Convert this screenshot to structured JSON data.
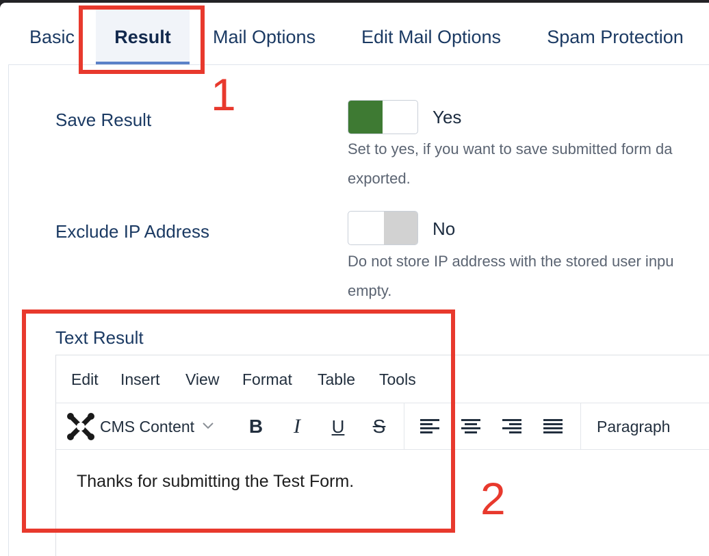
{
  "tabs": [
    {
      "label": "Basic"
    },
    {
      "label": "Result",
      "active": true
    },
    {
      "label": "Mail Options"
    },
    {
      "label": "Edit Mail Options"
    },
    {
      "label": "Spam Protection"
    }
  ],
  "fields": {
    "save_result": {
      "label": "Save Result",
      "value": "Yes",
      "hint_line1": "Set to yes, if you want to save submitted form da",
      "hint_line2": "exported."
    },
    "exclude_ip": {
      "label": "Exclude IP Address",
      "value": "No",
      "hint_line1": "Do not store IP address with the stored user inpu",
      "hint_line2": "empty."
    },
    "text_result": {
      "label": "Text Result"
    }
  },
  "editor": {
    "menu": [
      "Edit",
      "Insert",
      "View",
      "Format",
      "Table",
      "Tools"
    ],
    "cms_content_label": "CMS Content",
    "bold": "B",
    "italic": "I",
    "underline": "U",
    "strike": "S",
    "block_format": "Paragraph",
    "content": "Thanks for submitting the Test Form."
  },
  "annotations": [
    "1",
    "2"
  ],
  "colors": {
    "toggle_on": "#3e7a33",
    "toggle_off": "#d2d2d2",
    "annotation": "#e8392d",
    "tab_underline": "#5b82c8"
  }
}
